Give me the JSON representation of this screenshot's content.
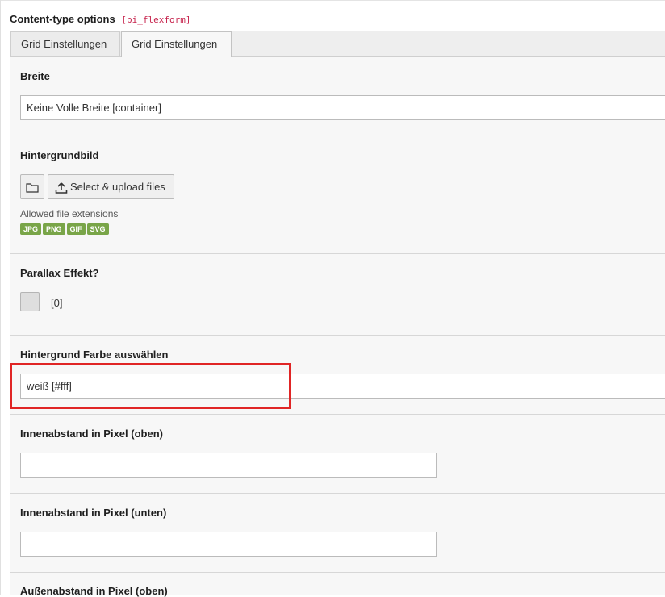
{
  "header": {
    "title": "Content-type options",
    "code": "[pi_flexform]"
  },
  "tabs": [
    {
      "label": "Grid Einstellungen"
    },
    {
      "label": "Grid Einstellungen"
    }
  ],
  "fields": {
    "breite": {
      "label": "Breite",
      "value": "Keine Volle Breite [container]"
    },
    "hintergrundbild": {
      "label": "Hintergrundbild",
      "upload_label": "Select & upload files",
      "allowed_label": "Allowed file extensions",
      "extensions": [
        "JPG",
        "PNG",
        "GIF",
        "SVG"
      ]
    },
    "parallax": {
      "label": "Parallax Effekt?",
      "value": "[0]"
    },
    "farbe": {
      "label": "Hintergrund Farbe auswählen",
      "value": "weiß [#fff]"
    },
    "padding_top": {
      "label": "Innenabstand in Pixel (oben)",
      "value": ""
    },
    "padding_bottom": {
      "label": "Innenabstand in Pixel (unten)",
      "value": ""
    },
    "margin_top": {
      "label": "Außenabstand in Pixel (oben)"
    }
  },
  "colors": {
    "highlight": "#e02525",
    "badge": "#79a548",
    "code": "#c7254e"
  }
}
